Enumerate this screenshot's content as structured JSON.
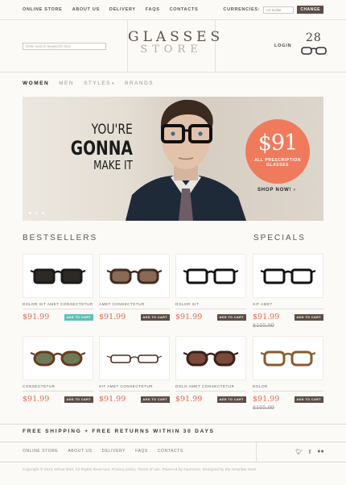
{
  "topbar": {
    "nav": [
      "ONLINE STORE",
      "ABOUT US",
      "DELIVERY",
      "FAQS",
      "CONTACTS"
    ],
    "currency_label": "CURRENCIES:",
    "currency_value": "US Dollar",
    "change_button": "CHANGE"
  },
  "header": {
    "search_placeholder": "Enter search keywords here",
    "logo_line1": "GLASSES",
    "logo_line2": "STORE",
    "login": "LOGIN",
    "cart_count": "28"
  },
  "catnav": {
    "items": [
      "WOMEN",
      "MEN",
      "STYLES",
      "BRANDS"
    ],
    "active": "WOMEN"
  },
  "banner": {
    "headline1": "YOU'RE",
    "headline2": "GONNA",
    "headline3": "MAKE IT",
    "price": "$91",
    "price_text_line1": "ALL PRESCRIPTION",
    "price_text_line2": "GLASSES",
    "cta": "SHOP NOW! ›"
  },
  "sections": {
    "bestsellers": "BESTSELLERS",
    "specials": "SPECIALS"
  },
  "products": [
    {
      "name": "DOLOR SIT AMET CONSECTETUR",
      "price": "$91.99",
      "old_price": "",
      "button": "ADD TO CART",
      "style": "dark-sun",
      "button_color": "#5fc0b6"
    },
    {
      "name": "AMET CONSECTETUR",
      "price": "$91.99",
      "old_price": "",
      "button": "ADD TO CART",
      "style": "brown-sun",
      "button_color": "#5c4d45"
    },
    {
      "name": "DOLOR SIT",
      "price": "$91.99",
      "old_price": "",
      "button": "ADD TO CART",
      "style": "black-frame",
      "button_color": "#5c4d45"
    },
    {
      "name": "SIT AMET",
      "price": "$91.99",
      "old_price": "$105.99",
      "button": "ADD TO CART",
      "style": "black-frame",
      "button_color": "#5c4d45"
    },
    {
      "name": "CONSECTETUR",
      "price": "$91.99",
      "old_price": "",
      "button": "ADD TO CART",
      "style": "round-tort",
      "button_color": "#5c4d45"
    },
    {
      "name": "SIT AMET CONSECTETUR",
      "price": "$91.99",
      "old_price": "",
      "button": "ADD TO CART",
      "style": "thin-rim",
      "button_color": "#5c4d45"
    },
    {
      "name": "DOLO AMET CONSECTETUR",
      "price": "$91.99",
      "old_price": "",
      "button": "ADD TO CART",
      "style": "brown-cat",
      "button_color": "#5c4d45"
    },
    {
      "name": "DOLOR",
      "price": "$91.99",
      "old_price": "$105.99",
      "button": "ADD TO CART",
      "style": "tort-frame",
      "button_color": "#5c4d45"
    }
  ],
  "footer": {
    "shipping": "FREE SHIPPING + FREE RETURNS WITHIN 30 DAYS",
    "nav": [
      "ONLINE STORE",
      "ABOUT US",
      "DELIVERY",
      "FAQS",
      "CONTACTS"
    ],
    "social": [
      "twitter-icon",
      "facebook-icon",
      "flickr-icon"
    ],
    "copyright": "Copyright © 2013 Yellow Mall. All Rights Reserved. Privacy policy. Terms of use. Powered by OpenCart. Designed by the template team."
  },
  "colors": {
    "accent": "#f07a5c",
    "price": "#e8654a",
    "button": "#5c4d45",
    "button_alt": "#5fc0b6"
  }
}
